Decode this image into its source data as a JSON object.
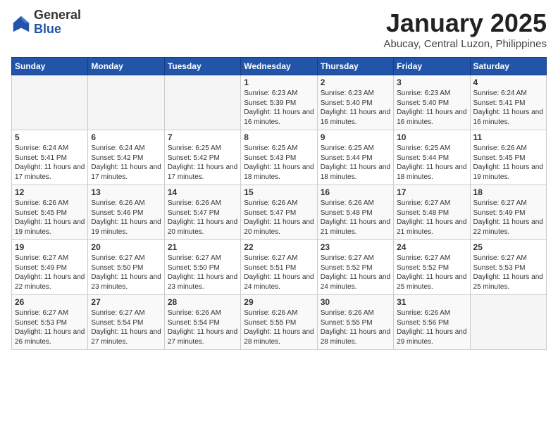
{
  "header": {
    "logo_general": "General",
    "logo_blue": "Blue",
    "title": "January 2025",
    "location": "Abucay, Central Luzon, Philippines"
  },
  "weekdays": [
    "Sunday",
    "Monday",
    "Tuesday",
    "Wednesday",
    "Thursday",
    "Friday",
    "Saturday"
  ],
  "weeks": [
    [
      {
        "day": "",
        "sunrise": "",
        "sunset": "",
        "daylight": ""
      },
      {
        "day": "",
        "sunrise": "",
        "sunset": "",
        "daylight": ""
      },
      {
        "day": "",
        "sunrise": "",
        "sunset": "",
        "daylight": ""
      },
      {
        "day": "1",
        "sunrise": "6:23 AM",
        "sunset": "5:39 PM",
        "daylight": "11 hours and 16 minutes."
      },
      {
        "day": "2",
        "sunrise": "6:23 AM",
        "sunset": "5:40 PM",
        "daylight": "11 hours and 16 minutes."
      },
      {
        "day": "3",
        "sunrise": "6:23 AM",
        "sunset": "5:40 PM",
        "daylight": "11 hours and 16 minutes."
      },
      {
        "day": "4",
        "sunrise": "6:24 AM",
        "sunset": "5:41 PM",
        "daylight": "11 hours and 16 minutes."
      }
    ],
    [
      {
        "day": "5",
        "sunrise": "6:24 AM",
        "sunset": "5:41 PM",
        "daylight": "11 hours and 17 minutes."
      },
      {
        "day": "6",
        "sunrise": "6:24 AM",
        "sunset": "5:42 PM",
        "daylight": "11 hours and 17 minutes."
      },
      {
        "day": "7",
        "sunrise": "6:25 AM",
        "sunset": "5:42 PM",
        "daylight": "11 hours and 17 minutes."
      },
      {
        "day": "8",
        "sunrise": "6:25 AM",
        "sunset": "5:43 PM",
        "daylight": "11 hours and 18 minutes."
      },
      {
        "day": "9",
        "sunrise": "6:25 AM",
        "sunset": "5:44 PM",
        "daylight": "11 hours and 18 minutes."
      },
      {
        "day": "10",
        "sunrise": "6:25 AM",
        "sunset": "5:44 PM",
        "daylight": "11 hours and 18 minutes."
      },
      {
        "day": "11",
        "sunrise": "6:26 AM",
        "sunset": "5:45 PM",
        "daylight": "11 hours and 19 minutes."
      }
    ],
    [
      {
        "day": "12",
        "sunrise": "6:26 AM",
        "sunset": "5:45 PM",
        "daylight": "11 hours and 19 minutes."
      },
      {
        "day": "13",
        "sunrise": "6:26 AM",
        "sunset": "5:46 PM",
        "daylight": "11 hours and 19 minutes."
      },
      {
        "day": "14",
        "sunrise": "6:26 AM",
        "sunset": "5:47 PM",
        "daylight": "11 hours and 20 minutes."
      },
      {
        "day": "15",
        "sunrise": "6:26 AM",
        "sunset": "5:47 PM",
        "daylight": "11 hours and 20 minutes."
      },
      {
        "day": "16",
        "sunrise": "6:26 AM",
        "sunset": "5:48 PM",
        "daylight": "11 hours and 21 minutes."
      },
      {
        "day": "17",
        "sunrise": "6:27 AM",
        "sunset": "5:48 PM",
        "daylight": "11 hours and 21 minutes."
      },
      {
        "day": "18",
        "sunrise": "6:27 AM",
        "sunset": "5:49 PM",
        "daylight": "11 hours and 22 minutes."
      }
    ],
    [
      {
        "day": "19",
        "sunrise": "6:27 AM",
        "sunset": "5:49 PM",
        "daylight": "11 hours and 22 minutes."
      },
      {
        "day": "20",
        "sunrise": "6:27 AM",
        "sunset": "5:50 PM",
        "daylight": "11 hours and 23 minutes."
      },
      {
        "day": "21",
        "sunrise": "6:27 AM",
        "sunset": "5:50 PM",
        "daylight": "11 hours and 23 minutes."
      },
      {
        "day": "22",
        "sunrise": "6:27 AM",
        "sunset": "5:51 PM",
        "daylight": "11 hours and 24 minutes."
      },
      {
        "day": "23",
        "sunrise": "6:27 AM",
        "sunset": "5:52 PM",
        "daylight": "11 hours and 24 minutes."
      },
      {
        "day": "24",
        "sunrise": "6:27 AM",
        "sunset": "5:52 PM",
        "daylight": "11 hours and 25 minutes."
      },
      {
        "day": "25",
        "sunrise": "6:27 AM",
        "sunset": "5:53 PM",
        "daylight": "11 hours and 25 minutes."
      }
    ],
    [
      {
        "day": "26",
        "sunrise": "6:27 AM",
        "sunset": "5:53 PM",
        "daylight": "11 hours and 26 minutes."
      },
      {
        "day": "27",
        "sunrise": "6:27 AM",
        "sunset": "5:54 PM",
        "daylight": "11 hours and 27 minutes."
      },
      {
        "day": "28",
        "sunrise": "6:26 AM",
        "sunset": "5:54 PM",
        "daylight": "11 hours and 27 minutes."
      },
      {
        "day": "29",
        "sunrise": "6:26 AM",
        "sunset": "5:55 PM",
        "daylight": "11 hours and 28 minutes."
      },
      {
        "day": "30",
        "sunrise": "6:26 AM",
        "sunset": "5:55 PM",
        "daylight": "11 hours and 28 minutes."
      },
      {
        "day": "31",
        "sunrise": "6:26 AM",
        "sunset": "5:56 PM",
        "daylight": "11 hours and 29 minutes."
      },
      {
        "day": "",
        "sunrise": "",
        "sunset": "",
        "daylight": ""
      }
    ]
  ]
}
